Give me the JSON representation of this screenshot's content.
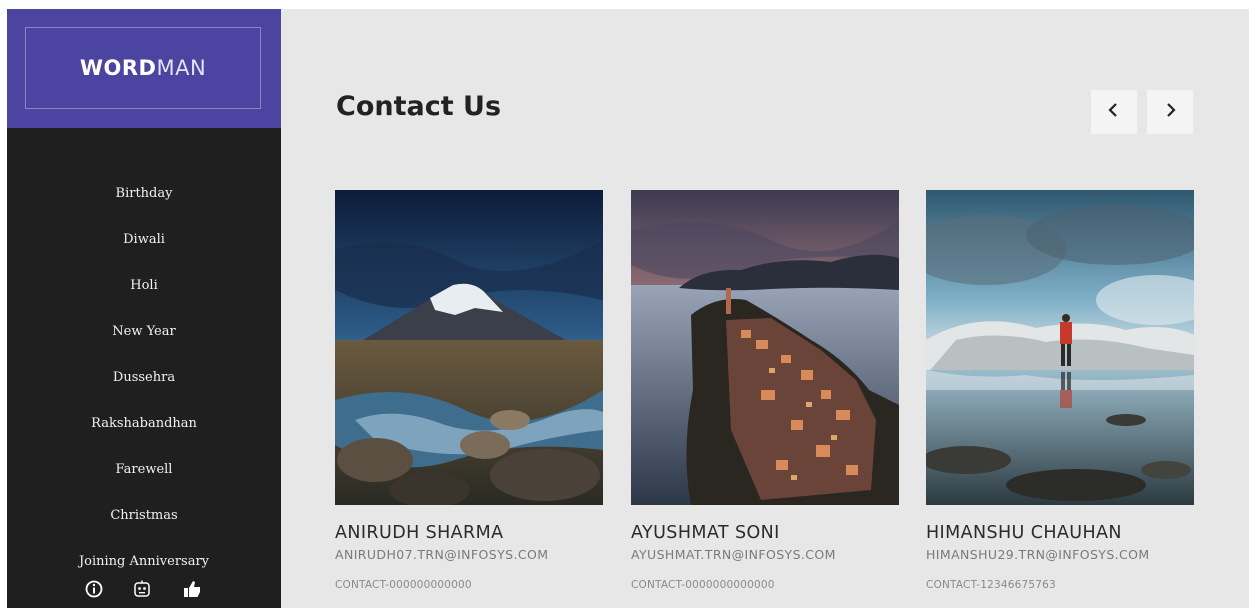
{
  "brand": {
    "bold": "WORD",
    "light": "MAN"
  },
  "sidebar": {
    "items": [
      {
        "label": "Birthday"
      },
      {
        "label": "Diwali"
      },
      {
        "label": "Holi"
      },
      {
        "label": "New Year"
      },
      {
        "label": "Dussehra"
      },
      {
        "label": "Rakshabandhan"
      },
      {
        "label": "Farewell"
      },
      {
        "label": "Christmas"
      },
      {
        "label": "Joining Anniversary"
      }
    ],
    "bottom_icons": [
      "info-icon",
      "robot-icon",
      "thumbs-up-icon"
    ]
  },
  "main": {
    "title": "Contact Us",
    "nav": {
      "prev": "‹",
      "next": "›"
    },
    "cards": [
      {
        "name": "ANIRUDH SHARMA",
        "email": "ANIRUDH07.TRN@INFOSYS.COM",
        "contact": "CONTACT-000000000000",
        "image": "mountain-river-photo"
      },
      {
        "name": "AYUSHMAT SONI",
        "email": "AYUSHMAT.TRN@INFOSYS.COM",
        "contact": "CONTACT-0000000000000",
        "image": "coastal-village-photo"
      },
      {
        "name": "HIMANSHU CHAUHAN",
        "email": "HIMANSHU29.TRN@INFOSYS.COM",
        "contact": "CONTACT-12346675763",
        "image": "glacier-hiker-photo"
      }
    ]
  },
  "colors": {
    "brand_bg": "#4b44a0",
    "sidebar_bg": "#1f1f1f",
    "main_bg": "#e7e7e7"
  }
}
